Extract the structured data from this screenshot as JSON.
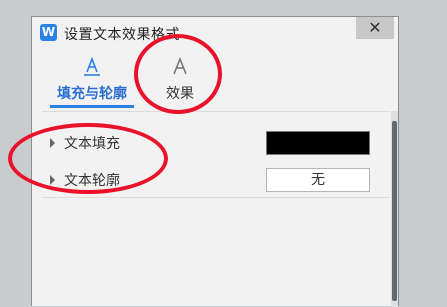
{
  "window": {
    "title": "设置文本效果格式",
    "app_icon_letter": "W",
    "close_label": "✕"
  },
  "tabs": [
    {
      "label": "填充与轮廓",
      "icon": "text-fill-outline-icon",
      "active": true
    },
    {
      "label": "效果",
      "icon": "text-effect-icon",
      "active": false
    }
  ],
  "rows": {
    "fill": {
      "label": "文本填充",
      "swatch_color": "#000000"
    },
    "line": {
      "label": "文本轮廓",
      "value": "无"
    }
  },
  "colors": {
    "accent": "#2a82e4",
    "annotation": "#e8132a"
  }
}
